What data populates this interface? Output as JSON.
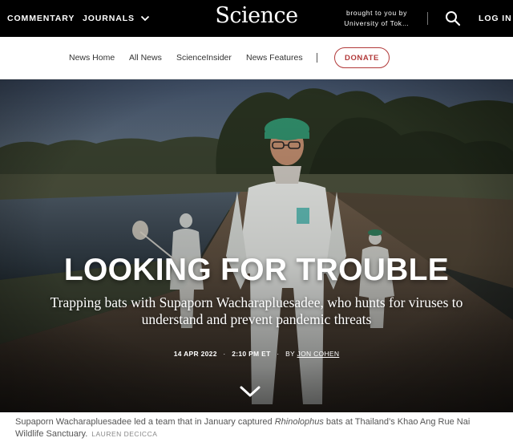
{
  "header": {
    "commentary": "COMMENTARY",
    "journals": "JOURNALS",
    "logo": "Science",
    "brought_line1": "brought to you by",
    "brought_line2": "University of Tok…",
    "login": "LOG IN",
    "icons": [
      "chevron-down-icon",
      "search-icon"
    ]
  },
  "subnav": {
    "items": [
      "News Home",
      "All News",
      "ScienceInsider",
      "News Features"
    ],
    "donate": "DONATE",
    "donate_color": "#b23a3a"
  },
  "hero": {
    "title": "LOOKING FOR TROUBLE",
    "dek": "Trapping bats with Supaporn Wacharapluesadee, who hunts for viruses to understand and prevent pandemic threats",
    "date": "14 APR 2022",
    "time": "2:10 PM ET",
    "by": "BY",
    "author": "JON COHEN",
    "scroll_icon": "chevron-down-icon"
  },
  "caption": {
    "text_before": "Supaporn Wacharapluesadee led a team that in January captured ",
    "italic": "Rhinolophus",
    "text_after": " bats at Thailand’s Khao Ang Rue Nai Wildlife Sanctuary.",
    "credit": "LAUREN DECICCA"
  }
}
